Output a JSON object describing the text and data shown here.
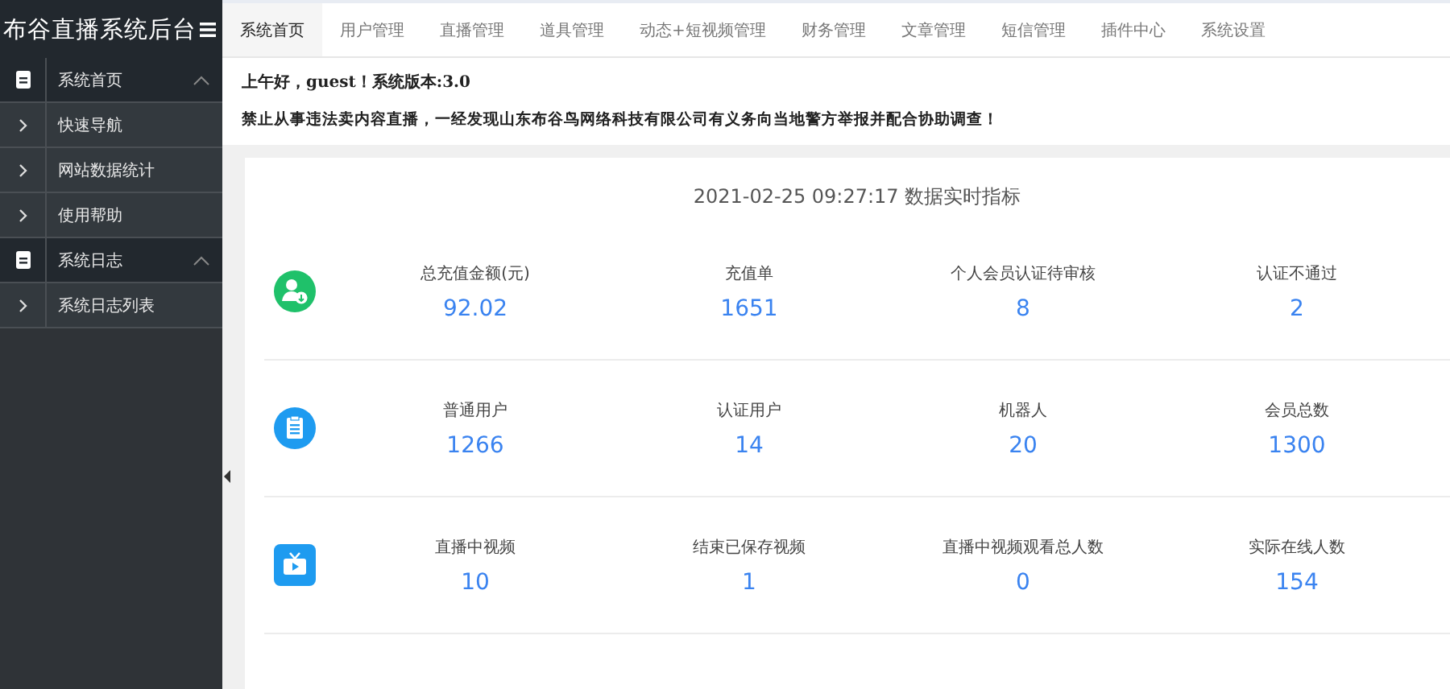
{
  "header": {
    "title": "布谷直播系统后台"
  },
  "nav_tabs": [
    {
      "label": "系统首页",
      "selected": true
    },
    {
      "label": "用户管理",
      "selected": false
    },
    {
      "label": "直播管理",
      "selected": false
    },
    {
      "label": "道具管理",
      "selected": false
    },
    {
      "label": "动态+短视频管理",
      "selected": false
    },
    {
      "label": "财务管理",
      "selected": false
    },
    {
      "label": "文章管理",
      "selected": false
    },
    {
      "label": "短信管理",
      "selected": false
    },
    {
      "label": "插件中心",
      "selected": false
    },
    {
      "label": "系统设置",
      "selected": false
    }
  ],
  "sidebar": {
    "groups": [
      {
        "label": "系统首页",
        "expanded": true,
        "children": [
          {
            "label": "快速导航"
          },
          {
            "label": "网站数据统计"
          },
          {
            "label": "使用帮助"
          }
        ]
      },
      {
        "label": "系统日志",
        "expanded": true,
        "children": [
          {
            "label": "系统日志列表"
          }
        ]
      }
    ]
  },
  "greeting": "上午好，guest！系统版本:3.0",
  "notice": "禁止从事违法卖内容直播，一经发现山东布谷鸟网络科技有限公司有义务向当地警方举报并配合协助调查！",
  "stats": {
    "title": "2021-02-25 09:27:17 数据实时指标",
    "rows": [
      {
        "kind": "finance",
        "items": [
          {
            "label": "总充值金额(元)",
            "value": "92.02"
          },
          {
            "label": "充值单",
            "value": "1651"
          },
          {
            "label": "个人会员认证待审核",
            "value": "8"
          },
          {
            "label": "认证不通过",
            "value": "2"
          }
        ]
      },
      {
        "kind": "users",
        "items": [
          {
            "label": "普通用户",
            "value": "1266"
          },
          {
            "label": "认证用户",
            "value": "14"
          },
          {
            "label": "机器人",
            "value": "20"
          },
          {
            "label": "会员总数",
            "value": "1300"
          }
        ]
      },
      {
        "kind": "live",
        "items": [
          {
            "label": "直播中视频",
            "value": "10"
          },
          {
            "label": "结束已保存视频",
            "value": "1"
          },
          {
            "label": "直播中视频观看总人数",
            "value": "0"
          },
          {
            "label": "实际在线人数",
            "value": "154"
          }
        ]
      }
    ]
  }
}
